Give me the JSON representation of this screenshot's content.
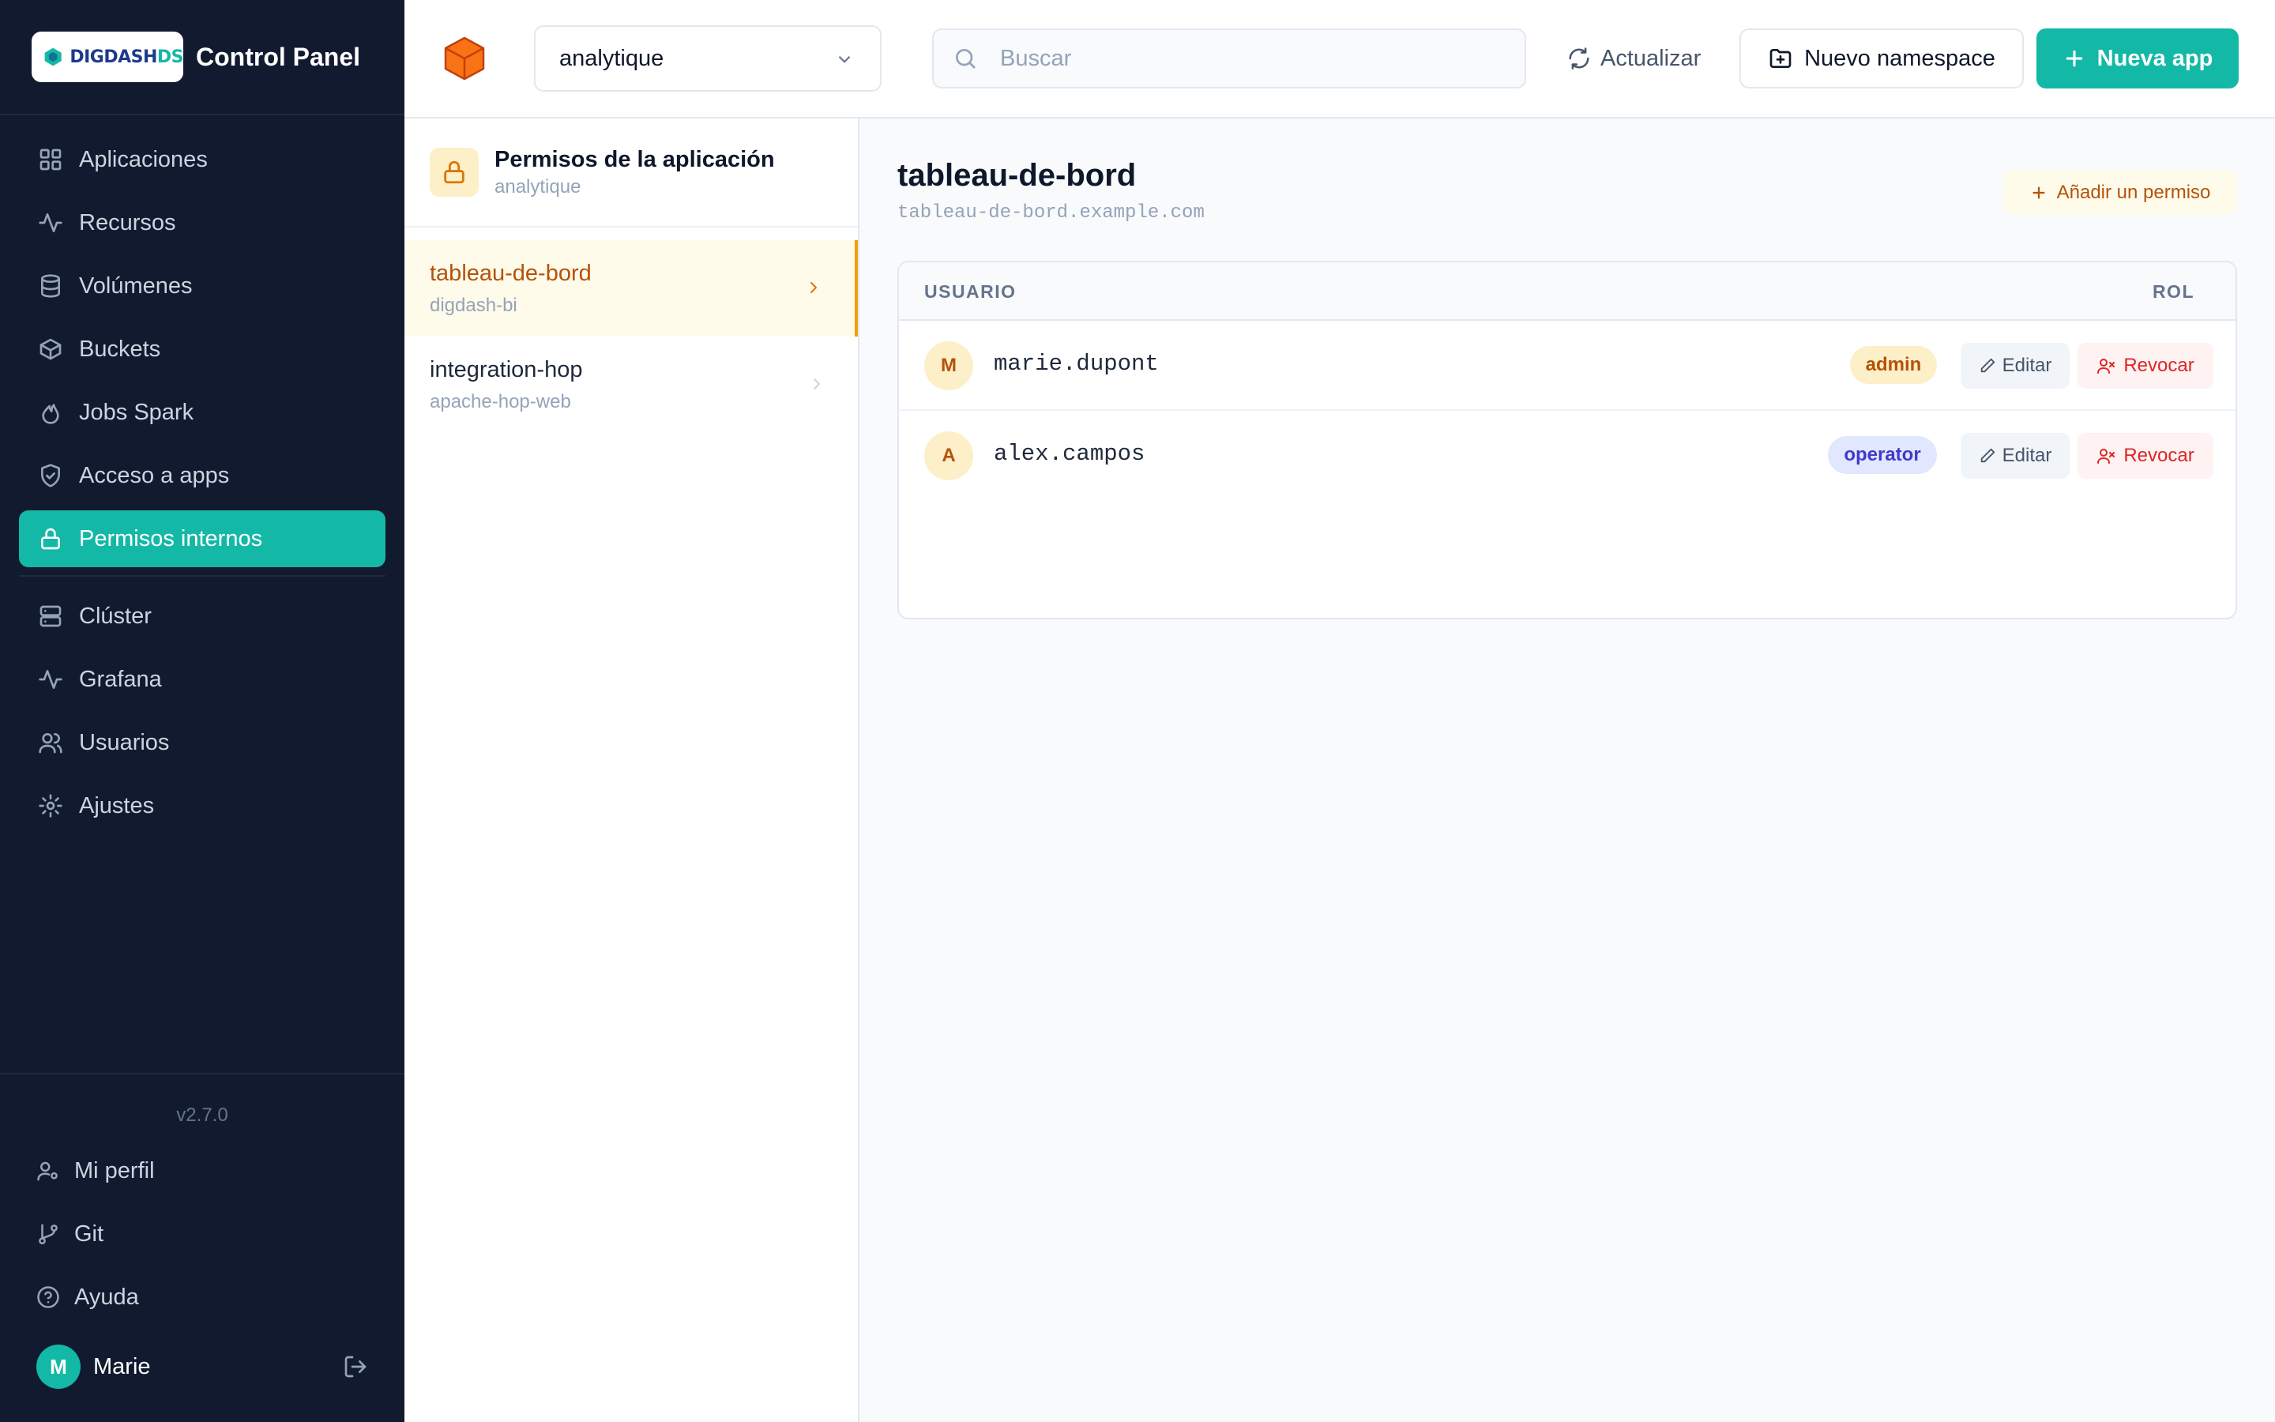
{
  "brand": {
    "logo_text_a": "DIGDASH",
    "logo_text_b": "DS",
    "title": "Control Panel",
    "accent": "#14b8a6"
  },
  "sidebar": {
    "items": [
      {
        "label": "Aplicaciones",
        "icon": "grid-icon",
        "active": false
      },
      {
        "label": "Recursos",
        "icon": "activity-icon",
        "active": false
      },
      {
        "label": "Volúmenes",
        "icon": "database-icon",
        "active": false
      },
      {
        "label": "Buckets",
        "icon": "box-icon",
        "active": false
      },
      {
        "label": "Jobs Spark",
        "icon": "flame-icon",
        "active": false
      },
      {
        "label": "Acceso a apps",
        "icon": "shield-icon",
        "active": false
      },
      {
        "label": "Permisos internos",
        "icon": "lock-icon",
        "active": true
      },
      {
        "label": "Clúster",
        "icon": "server-icon",
        "active": false
      },
      {
        "label": "Grafana",
        "icon": "activity-icon",
        "active": false
      },
      {
        "label": "Usuarios",
        "icon": "users-icon",
        "active": false
      },
      {
        "label": "Ajustes",
        "icon": "gear-icon",
        "active": false
      }
    ],
    "version": "v2.7.0",
    "bottom": [
      {
        "label": "Mi perfil",
        "icon": "user-cog-icon"
      },
      {
        "label": "Git",
        "icon": "git-branch-icon"
      },
      {
        "label": "Ayuda",
        "icon": "help-icon"
      }
    ],
    "user": {
      "initial": "M",
      "name": "Marie"
    }
  },
  "topbar": {
    "namespace": "analytique",
    "search_placeholder": "Buscar",
    "refresh_label": "Actualizar",
    "new_namespace_label": "Nuevo namespace",
    "new_app_label": "Nueva app"
  },
  "panel": {
    "title": "Permisos de la aplicación",
    "subtitle": "analytique",
    "apps": [
      {
        "name": "tableau-de-bord",
        "sub": "digdash-bi",
        "active": true
      },
      {
        "name": "integration-hop",
        "sub": "apache-hop-web",
        "active": false
      }
    ]
  },
  "main": {
    "title": "tableau-de-bord",
    "url": "tableau-de-bord.example.com",
    "add_label": "Añadir un permiso",
    "columns": {
      "user": "USUARIO",
      "role": "ROL"
    },
    "rows": [
      {
        "initial": "M",
        "user": "marie.dupont",
        "role": "admin",
        "edit": "Editar",
        "revoke": "Revocar"
      },
      {
        "initial": "A",
        "user": "alex.campos",
        "role": "operator",
        "edit": "Editar",
        "revoke": "Revocar"
      }
    ]
  },
  "colors": {
    "sidebar_bg": "#111a2e",
    "primary": "#14b8a6",
    "amber": "#d97706",
    "danger": "#dc2626",
    "indigo": "#4338ca"
  }
}
